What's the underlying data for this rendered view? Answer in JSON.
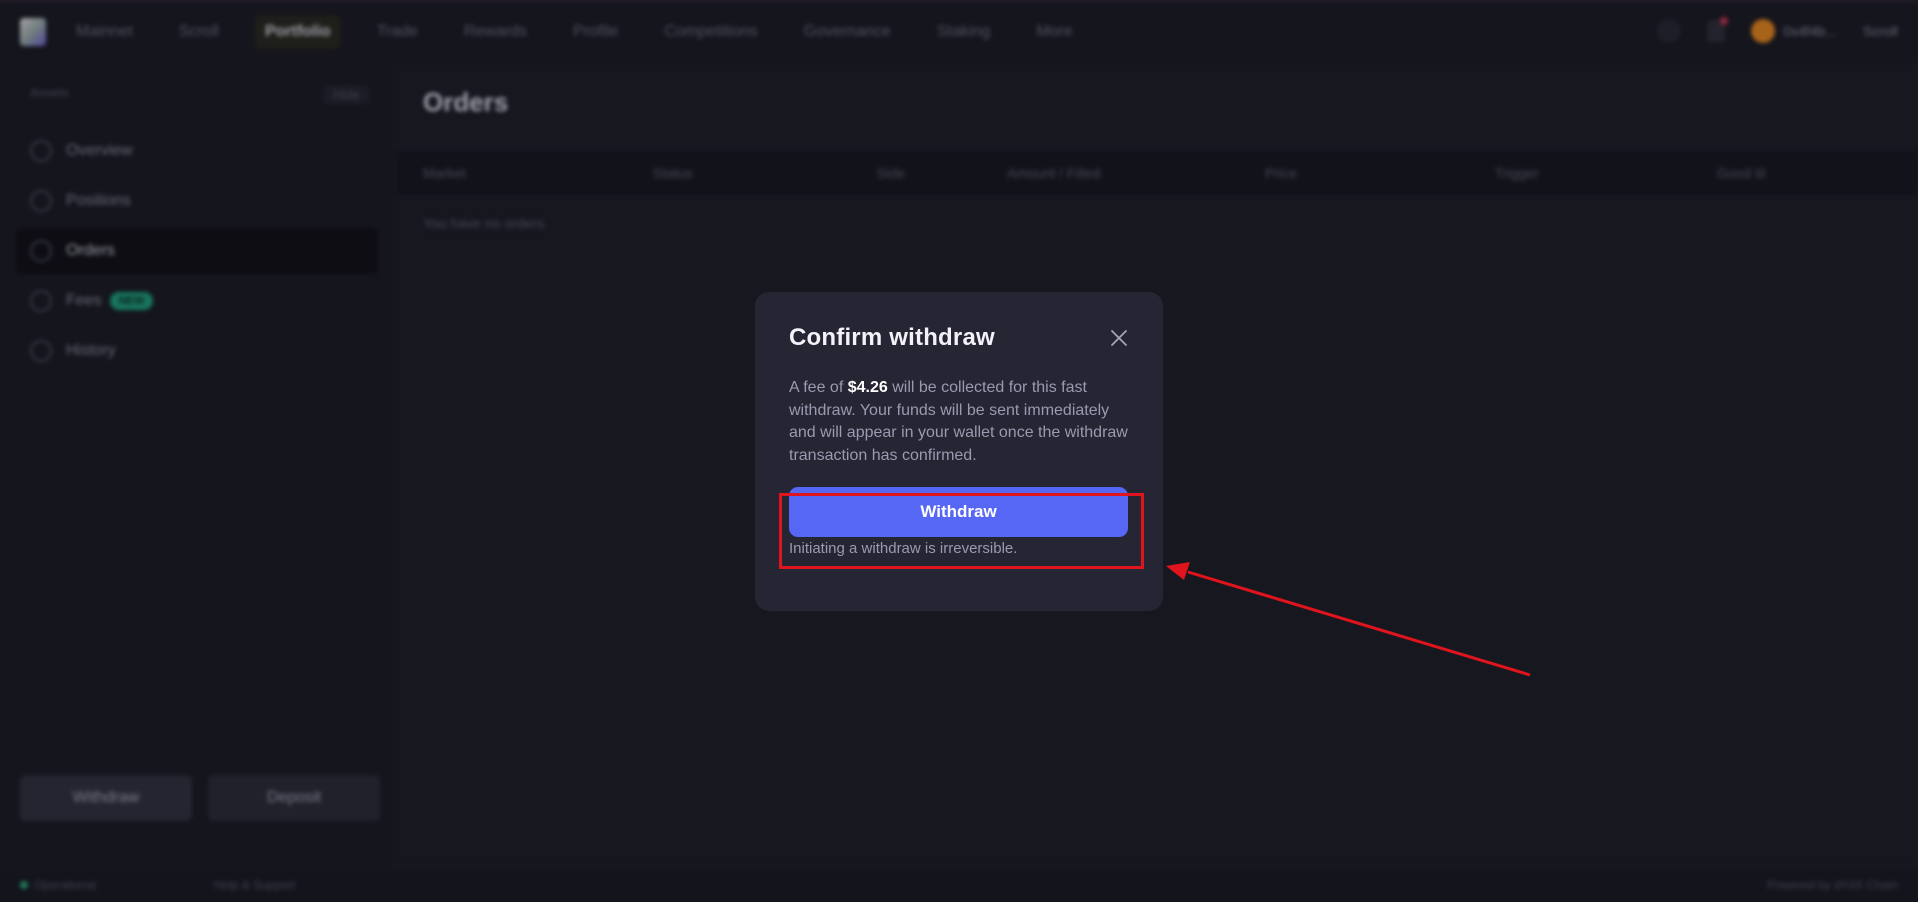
{
  "topbar": {
    "network": "Mainnet",
    "chain": "Scroll",
    "nav": [
      "Portfolio",
      "Trade",
      "Rewards",
      "Profile",
      "Competitions",
      "Governance",
      "Staking",
      "More"
    ],
    "account_label": "0x4f4b...",
    "account_chain": "Scroll"
  },
  "sidebar": {
    "header": "Assets",
    "header_action": "Hide",
    "items": [
      {
        "label": "Overview",
        "icon": "overview-icon"
      },
      {
        "label": "Positions",
        "icon": "positions-icon"
      },
      {
        "label": "Orders",
        "icon": "orders-icon",
        "active": true
      },
      {
        "label": "Fees",
        "icon": "fees-icon",
        "badge": "NEW"
      },
      {
        "label": "History",
        "icon": "history-icon"
      }
    ],
    "withdraw_label": "Withdraw",
    "deposit_label": "Deposit"
  },
  "main": {
    "title": "Orders",
    "columns": [
      "Market",
      "Status",
      "Side",
      "Amount / Filled",
      "Price",
      "Trigger",
      "Good til"
    ],
    "empty": "You have no orders."
  },
  "footer": {
    "status": "Operational",
    "help": "Help & Support",
    "powered": "Powered by dYdX Chain"
  },
  "modal": {
    "title": "Confirm withdraw",
    "fee_prefix": "A fee of ",
    "fee_amount": "$4.26",
    "fee_suffix": " will be collected for this fast withdraw. Your funds will be sent immediately and will appear in your wallet once the withdraw transaction has confirmed.",
    "button_label": "Withdraw",
    "note": "Initiating a withdraw is irreversible."
  },
  "colors": {
    "accent": "#5767f5",
    "annotation": "#e0141c",
    "modal_bg": "#262533",
    "page_bg": "#1c1c28"
  }
}
